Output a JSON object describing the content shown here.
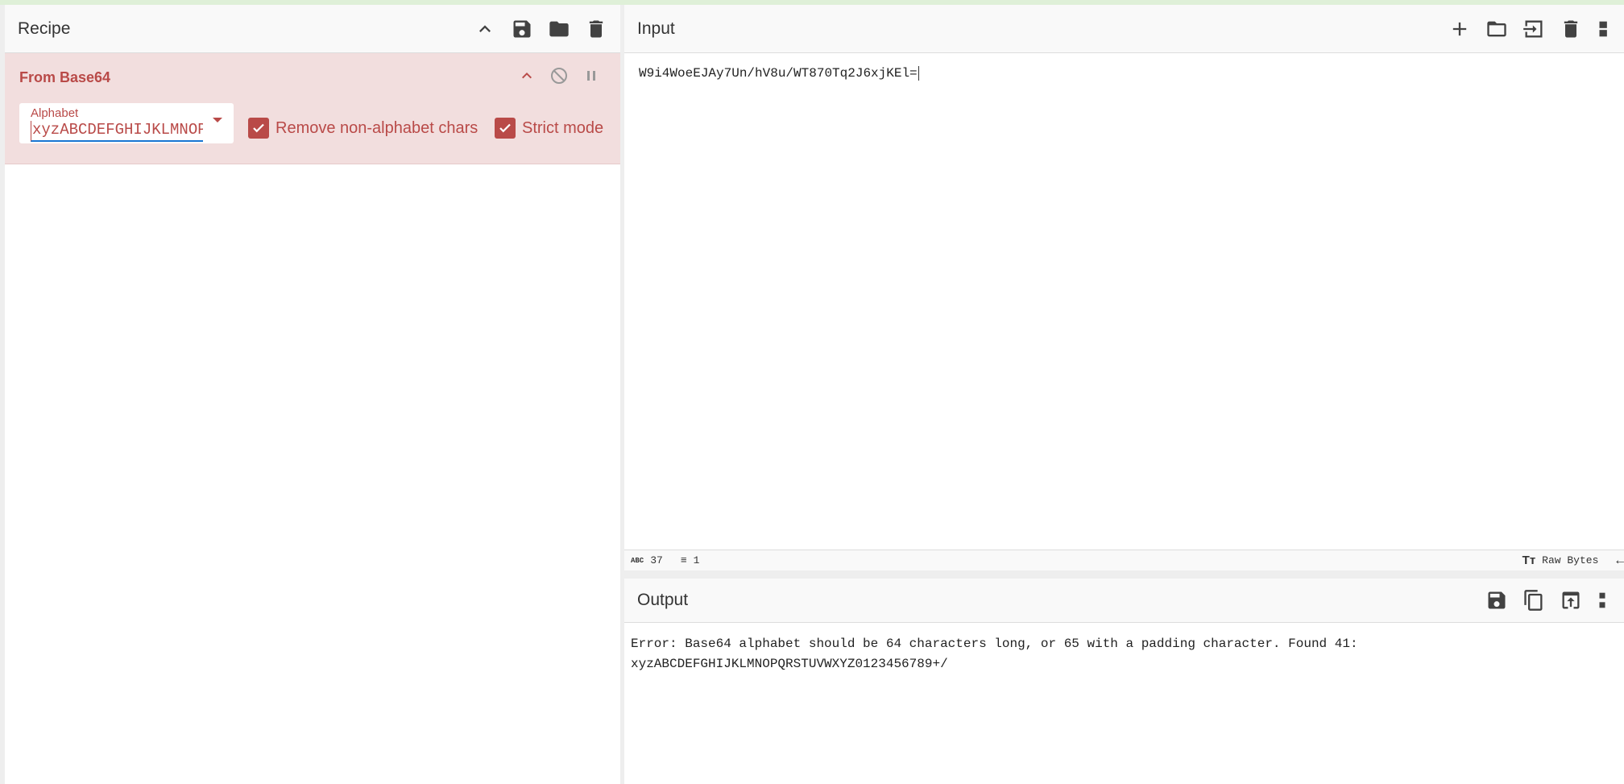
{
  "recipe": {
    "title": "Recipe",
    "icons": [
      "chevron-up-icon",
      "save-icon",
      "folder-icon",
      "trash-icon"
    ]
  },
  "operation": {
    "name": "From Base64",
    "alphabet_label": "Alphabet",
    "alphabet_value": "xyzABCDEFGHIJKLMNOPQRSTUVWXYZ0123456789+/",
    "remove_label": "Remove non-alphabet chars",
    "remove_checked": true,
    "strict_label": "Strict mode",
    "strict_checked": true
  },
  "input": {
    "title": "Input",
    "value": "W9i4WoeEJAy7Un/hV8u/WT870Tq2J6xjKEl=",
    "chars": "37",
    "lines": "1",
    "raw_bytes": "Raw Bytes"
  },
  "output": {
    "title": "Output",
    "line1": "Error: Base64 alphabet should be 64 characters long, or 65 with a padding character. Found 41:",
    "line2": "xyzABCDEFGHIJKLMNOPQRSTUVWXYZ0123456789+/"
  },
  "colors": {
    "accent": "#b94a48",
    "op_bg": "#f2dede",
    "top_bar": "#dff0d8"
  }
}
